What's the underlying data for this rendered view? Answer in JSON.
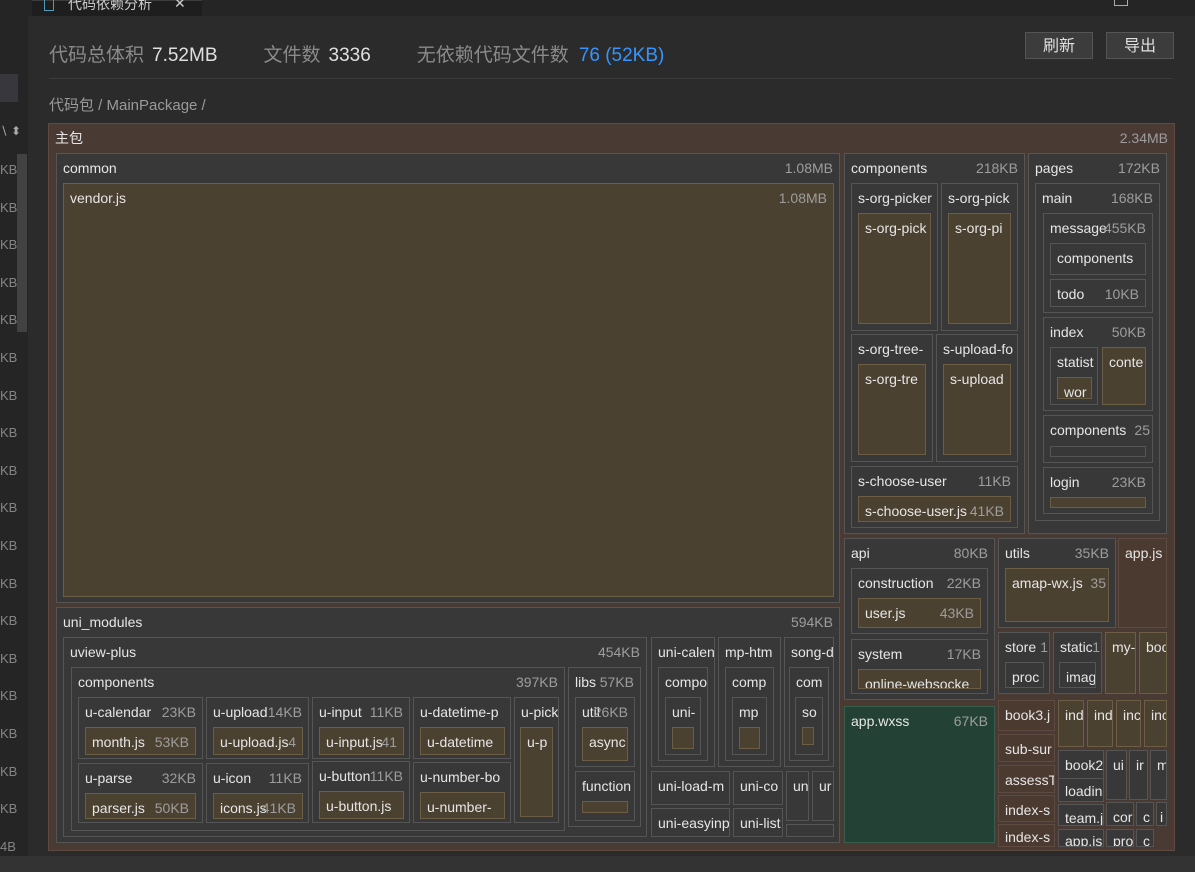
{
  "tab": {
    "title": "代码依赖分析",
    "close": "✕"
  },
  "sidebar_sizes": [
    "KB",
    "KB",
    "KB",
    "KB",
    "KB",
    "KB",
    "KB",
    "KB",
    "KB",
    "KB",
    "KB",
    "KB",
    "KB",
    "KB",
    "KB",
    "KB",
    "KB",
    "KB",
    "4B"
  ],
  "stats": {
    "total_label": "代码总体积",
    "total_value": "7.52MB",
    "files_label": "文件数",
    "files_value": "3336",
    "nodep_label": "无依赖代码文件数",
    "nodep_value": "76 (52KB)"
  },
  "buttons": {
    "refresh": "刷新",
    "export": "导出"
  },
  "breadcrumb": "代码包 / MainPackage /",
  "treemap": {
    "root": {
      "label": "主包",
      "size": "2.34MB"
    },
    "common": {
      "label": "common",
      "size": "1.08MB"
    },
    "vendor": {
      "label": "vendor.js",
      "size": "1.08MB"
    },
    "uni_modules": {
      "label": "uni_modules",
      "size": "594KB"
    },
    "uview_plus": {
      "label": "uview-plus",
      "size": "454KB"
    },
    "uv_components": {
      "label": "components",
      "size": "397KB"
    },
    "u_calendar": {
      "label": "u-calendar",
      "size": "23KB"
    },
    "month_js": {
      "label": "month.js",
      "size": "53KB"
    },
    "u_upload": {
      "label": "u-upload",
      "size": "14KB"
    },
    "u_upload_js": {
      "label": "u-upload.js",
      "size": "4"
    },
    "u_input": {
      "label": "u-input",
      "size": "11KB"
    },
    "u_input_js": {
      "label": "u-input.js",
      "size": "41"
    },
    "u_datetime": {
      "label": "u-datetime-p"
    },
    "u_datetime_js": {
      "label": "u-datetime"
    },
    "u_pick": {
      "label": "u-pick"
    },
    "u_p": {
      "label": "u-p"
    },
    "u_parse": {
      "label": "u-parse",
      "size": "32KB"
    },
    "parser_js": {
      "label": "parser.js",
      "size": "50KB"
    },
    "u_icon": {
      "label": "u-icon",
      "size": "11KB"
    },
    "icons_js": {
      "label": "icons.js",
      "size": "41KB"
    },
    "u_button": {
      "label": "u-button",
      "size": "11KB"
    },
    "u_button_js": {
      "label": "u-button.js"
    },
    "u_number": {
      "label": "u-number-bo"
    },
    "u_number_js": {
      "label": "u-number-"
    },
    "libs": {
      "label": "libs",
      "size": "57KB"
    },
    "util": {
      "label": "util",
      "size": "26KB"
    },
    "async": {
      "label": "async"
    },
    "function": {
      "label": "function"
    },
    "uni_calendar": {
      "label": "uni-calen"
    },
    "uc_comp": {
      "label": "compo"
    },
    "uc_uni": {
      "label": "uni-"
    },
    "mp_html": {
      "label": "mp-htm"
    },
    "mp_comp": {
      "label": "comp"
    },
    "mp_mp": {
      "label": "mp"
    },
    "song": {
      "label": "song-d"
    },
    "song_comp": {
      "label": "com"
    },
    "song_so": {
      "label": "so"
    },
    "uni_load": {
      "label": "uni-load-m"
    },
    "uni_co": {
      "label": "uni-co"
    },
    "un1": {
      "label": "un"
    },
    "ur1": {
      "label": "ur"
    },
    "uni_easying": {
      "label": "uni-easyinp"
    },
    "uni_list": {
      "label": "uni-list"
    },
    "components": {
      "label": "components",
      "size": "218KB"
    },
    "s_org_picker": {
      "label": "s-org-picker"
    },
    "s_org_pick_inner": {
      "label": "s-org-pick"
    },
    "s_org_pick2": {
      "label": "s-org-pick"
    },
    "s_org_pi": {
      "label": "s-org-pi"
    },
    "s_org_tree": {
      "label": "s-org-tree-"
    },
    "s_org_tre": {
      "label": "s-org-tre"
    },
    "s_upload_fo": {
      "label": "s-upload-fo"
    },
    "s_upload": {
      "label": "s-upload"
    },
    "s_choose_user": {
      "label": "s-choose-user",
      "size": "11KB"
    },
    "s_choose_user_js": {
      "label": "s-choose-user.js",
      "size": "41KB"
    },
    "pages": {
      "label": "pages",
      "size": "172KB"
    },
    "pg_main": {
      "label": "main",
      "size": "168KB"
    },
    "message": {
      "label": "message",
      "size": "455KB"
    },
    "msg_components": {
      "label": "components"
    },
    "todo": {
      "label": "todo",
      "size": "10KB"
    },
    "index": {
      "label": "index",
      "size": "50KB"
    },
    "statist": {
      "label": "statist"
    },
    "wor": {
      "label": "wor"
    },
    "conte": {
      "label": "conte"
    },
    "pg_components": {
      "label": "components",
      "size": "25"
    },
    "login": {
      "label": "login",
      "size": "23KB"
    },
    "api": {
      "label": "api",
      "size": "80KB"
    },
    "construction": {
      "label": "construction",
      "size": "22KB"
    },
    "user_js": {
      "label": "user.js",
      "size": "43KB"
    },
    "system": {
      "label": "system",
      "size": "17KB"
    },
    "online_ws": {
      "label": "online-websocke"
    },
    "utils": {
      "label": "utils",
      "size": "35KB"
    },
    "amap": {
      "label": "amap-wx.js",
      "size": "35"
    },
    "app_js": {
      "label": "app.js"
    },
    "store": {
      "label": "store",
      "size": "1"
    },
    "proc": {
      "label": "proc"
    },
    "static": {
      "label": "static",
      "size": "1"
    },
    "imag": {
      "label": "imag"
    },
    "my": {
      "label": "my-"
    },
    "boo": {
      "label": "boo"
    },
    "app_wxss": {
      "label": "app.wxss",
      "size": "67KB"
    },
    "book3": {
      "label": "book3.j"
    },
    "ind": [
      "ind",
      "ind",
      "inc",
      "inc"
    ],
    "sub_sur": {
      "label": "sub-sur"
    },
    "book2": {
      "label": "book2"
    },
    "ui": {
      "label": "ui"
    },
    "ir": {
      "label": "ir"
    },
    "m": {
      "label": "m"
    },
    "assess": {
      "label": "assessT"
    },
    "loadin": {
      "label": "loadin"
    },
    "index_s1": {
      "label": "index-s"
    },
    "team": {
      "label": "team.j"
    },
    "cor": {
      "label": "cor"
    },
    "c1": {
      "label": "c"
    },
    "i1": {
      "label": "i"
    },
    "index_s2": {
      "label": "index-s"
    },
    "app_js2": {
      "label": "app.js"
    },
    "pro": {
      "label": "pro"
    },
    "c2": {
      "label": "c"
    }
  }
}
